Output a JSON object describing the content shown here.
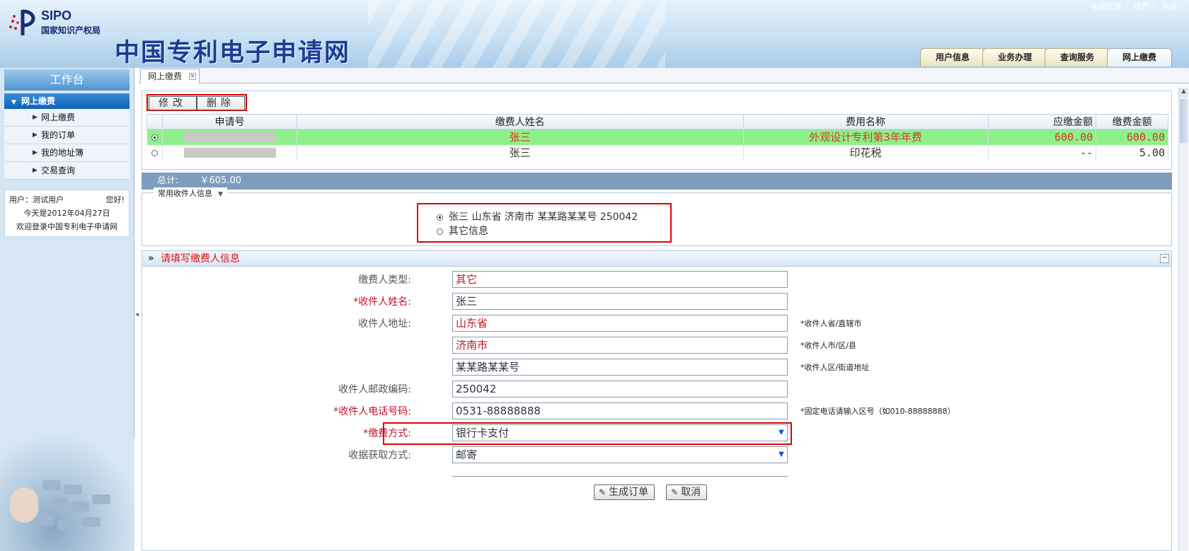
{
  "header": {
    "logo_en": "SIPO",
    "logo_cn": "国家知识产权局",
    "site_title": "中国专利电子申请网",
    "top_links": [
      "在线交流",
      "首页",
      "关闭"
    ],
    "main_tabs": [
      "用户信息",
      "业务办理",
      "查询服务",
      "网上缴费"
    ]
  },
  "sidebar": {
    "title": "工作台",
    "section": "网上缴费",
    "items": [
      "网上缴费",
      "我的订单",
      "我的地址簿",
      "交易查询"
    ],
    "user_line": "用户：测试用户",
    "greeting": "您好!",
    "date_line": "今天是2012年04月27日",
    "welcome": "欢迎登录中国专利电子申请网"
  },
  "content": {
    "tab_label": "网上缴费",
    "fee_table": {
      "buttons": [
        "修改",
        "删除"
      ],
      "headers": [
        "申请号",
        "缴费人姓名",
        "费用名称",
        "应缴金额",
        "缴费金额"
      ],
      "rows": [
        {
          "payer": "张三",
          "fee_name": "外观设计专利第3年年费",
          "due": "600.00",
          "paid": "600.00",
          "selected": true
        },
        {
          "payer": "张三",
          "fee_name": "印花税",
          "due": "--",
          "paid": "5.00",
          "selected": false
        }
      ],
      "total_label": "总计:",
      "total_amount": "￥605.00"
    },
    "recipient": {
      "legend": "常用收件人信息",
      "options": [
        {
          "text": "张三 山东省 济南市 某某路某某号 250042",
          "checked": true
        },
        {
          "text": "其它信息",
          "checked": false
        }
      ]
    },
    "payer_form": {
      "title": "请填写缴费人信息",
      "payer_type_label": "缴费人类型:",
      "payer_type": "其它",
      "name_label": "*收件人姓名:",
      "name": "张三",
      "address_label": "收件人地址:",
      "province": "山东省",
      "province_hint": "*收件人省/直辖市",
      "city": "济南市",
      "city_hint": "*收件人市/区/县",
      "street": "某某路某某号",
      "street_hint": "*收件人区/街道地址",
      "zip_label": "收件人邮政编码:",
      "zip": "250042",
      "phone_label": "*收件人电话号码:",
      "phone": "0531-88888888",
      "phone_hint": "*固定电话请输入区号（如010-88888888）",
      "paymethod_label": "*缴费方式:",
      "paymethod": "银行卡支付",
      "receipt_label": "收据获取方式:",
      "receipt": "邮寄",
      "submit_label": "生成订单",
      "cancel_label": "取消"
    }
  }
}
